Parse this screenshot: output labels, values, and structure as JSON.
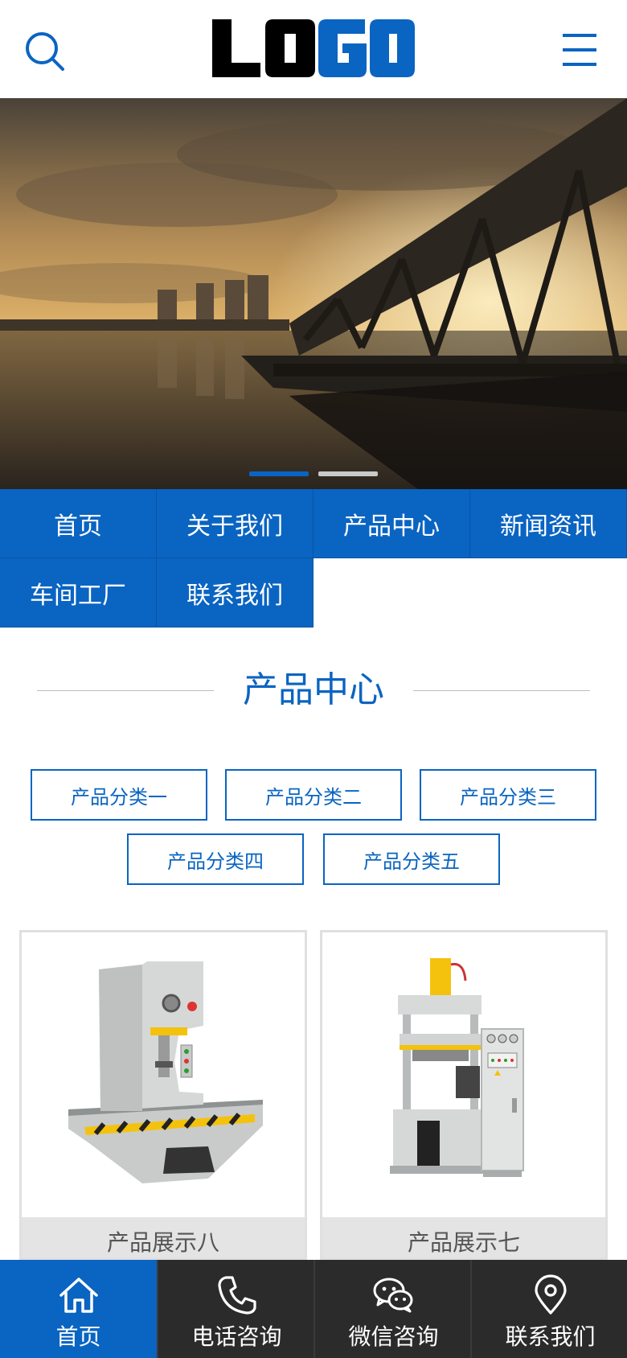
{
  "header": {
    "logo_text": "LOGO",
    "search_icon": "search-icon",
    "menu_icon": "hamburger-menu-icon"
  },
  "banner": {
    "slides": 2,
    "active_slide": 1
  },
  "nav": {
    "items": [
      {
        "label": "首页"
      },
      {
        "label": "关于我们"
      },
      {
        "label": "产品中心"
      },
      {
        "label": "新闻资讯"
      },
      {
        "label": "车间工厂"
      },
      {
        "label": "联系我们"
      }
    ]
  },
  "products": {
    "title": "产品中心",
    "categories": [
      {
        "label": "产品分类一"
      },
      {
        "label": "产品分类二"
      },
      {
        "label": "产品分类三"
      },
      {
        "label": "产品分类四"
      },
      {
        "label": "产品分类五"
      }
    ],
    "items": [
      {
        "caption": "产品展示八"
      },
      {
        "caption": "产品展示七"
      }
    ]
  },
  "footer": {
    "items": [
      {
        "label": "首页",
        "icon": "home-icon"
      },
      {
        "label": "电话咨询",
        "icon": "phone-icon"
      },
      {
        "label": "微信咨询",
        "icon": "wechat-icon"
      },
      {
        "label": "联系我们",
        "icon": "location-pin-icon"
      }
    ]
  },
  "colors": {
    "brand_blue": "#0a64c2",
    "footer_dark": "#2b2b2b",
    "caption_gray": "#e4e4e4"
  }
}
